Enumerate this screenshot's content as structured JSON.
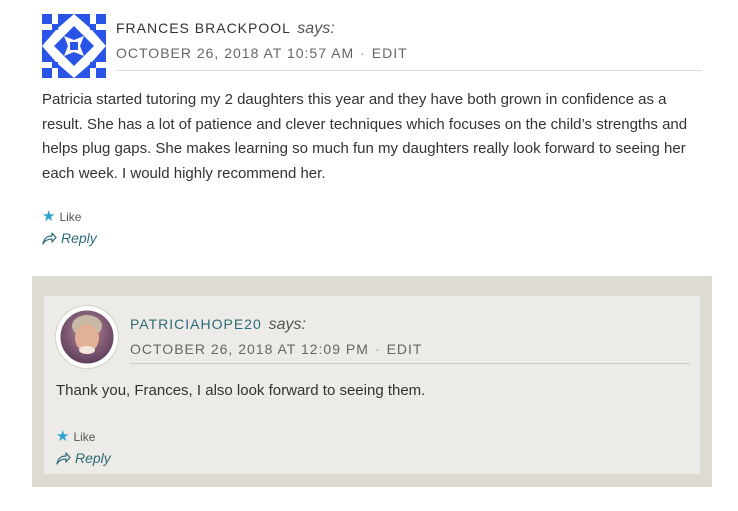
{
  "comments": [
    {
      "author": "FRANCES BRACKPOOL",
      "says": "says:",
      "date": "OCTOBER 26, 2018 AT 10:57 AM",
      "edit": "EDIT",
      "text": "Patricia started tutoring my 2 daughters this year and they have both grown in confidence as a result. She has a lot of patience and clever techniques which focuses on the child’s strengths and helps plug gaps. She makes learning so much fun my daughters really look forward to seeing her each week. I would highly recommend her.",
      "like": "Like",
      "reply": "Reply"
    },
    {
      "author": "PATRICIAHOPE20",
      "says": "says:",
      "date": "OCTOBER 26, 2018 AT 12:09 PM",
      "edit": "EDIT",
      "text": "Thank you, Frances, I also look forward to seeing them.",
      "like": "Like",
      "reply": "Reply"
    }
  ],
  "colors": {
    "accent": "#2b6b77",
    "star": "#2ea2cc",
    "reply_bg": "#dedbd3",
    "reply_inner_bg": "#ecebe7",
    "identicon": "#2a54e8"
  },
  "icons": {
    "like": "star-icon",
    "reply": "reply-arrow-icon",
    "avatar1": "identicon-avatar",
    "avatar2": "user-photo-avatar"
  }
}
